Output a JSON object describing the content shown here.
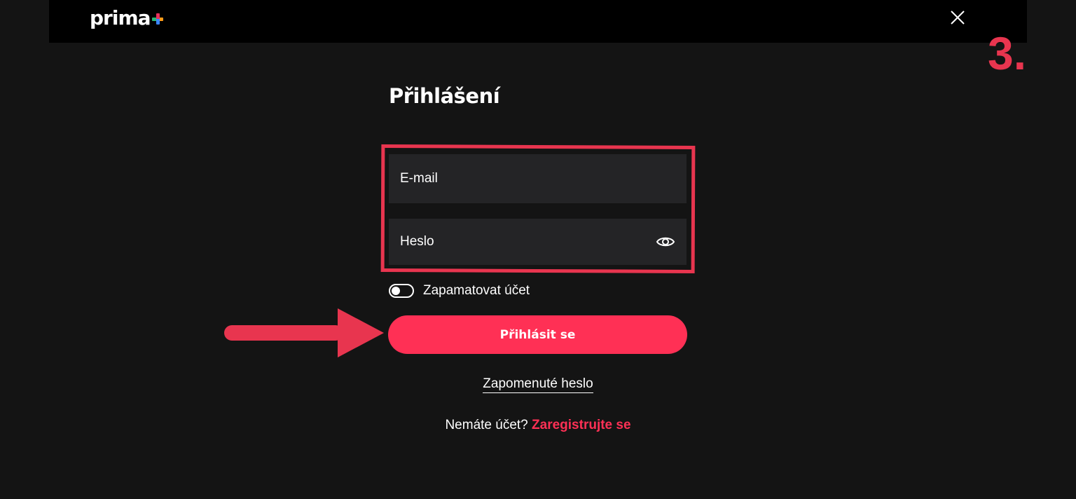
{
  "header": {
    "logo_text": "prima",
    "close_icon": "close-icon"
  },
  "annotation": {
    "step_label": "3.",
    "color": "#e8354f"
  },
  "login": {
    "title": "Přihlášení",
    "email_placeholder": "E-mail",
    "password_placeholder": "Heslo",
    "password_visibility_icon": "eye-icon",
    "remember_label": "Zapamatovat účet",
    "remember_checked": false,
    "submit_label": "Přihlásit se",
    "forgot_label": "Zapomenuté heslo",
    "register_prompt": "Nemáte účet?",
    "register_link": "Zaregistrujte se"
  },
  "colors": {
    "accent": "#ff3055",
    "background": "#141414",
    "topbar": "#000000",
    "field_bg": "#242426"
  }
}
